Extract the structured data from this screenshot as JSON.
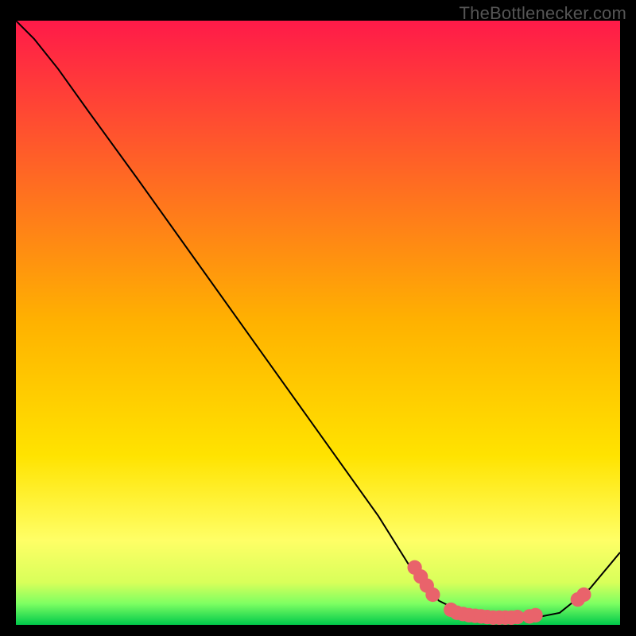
{
  "watermark": "TheBottlenecker.com",
  "chart_data": {
    "type": "line",
    "title": "",
    "xlabel": "",
    "ylabel": "",
    "xlim": [
      0,
      100
    ],
    "ylim": [
      0,
      100
    ],
    "gradient_colors": {
      "top": "#ff1a49",
      "mid": "#ffe300",
      "low_band": "#ffff66",
      "green_top": "#7dff62",
      "green_bottom": "#00c84b"
    },
    "curve": [
      {
        "x": 0,
        "y": 100
      },
      {
        "x": 3,
        "y": 97
      },
      {
        "x": 7,
        "y": 92
      },
      {
        "x": 12,
        "y": 85
      },
      {
        "x": 20,
        "y": 74
      },
      {
        "x": 30,
        "y": 60
      },
      {
        "x": 40,
        "y": 46
      },
      {
        "x": 50,
        "y": 32
      },
      {
        "x": 60,
        "y": 18
      },
      {
        "x": 65,
        "y": 10
      },
      {
        "x": 70,
        "y": 4
      },
      {
        "x": 75,
        "y": 1.5
      },
      {
        "x": 80,
        "y": 1
      },
      {
        "x": 85,
        "y": 1
      },
      {
        "x": 90,
        "y": 2
      },
      {
        "x": 95,
        "y": 6
      },
      {
        "x": 100,
        "y": 12
      }
    ],
    "markers": [
      {
        "x": 66,
        "y": 9.5
      },
      {
        "x": 67,
        "y": 8
      },
      {
        "x": 68,
        "y": 6.5
      },
      {
        "x": 69,
        "y": 5
      },
      {
        "x": 72,
        "y": 2.5
      },
      {
        "x": 73,
        "y": 2
      },
      {
        "x": 74,
        "y": 1.8
      },
      {
        "x": 75,
        "y": 1.6
      },
      {
        "x": 76,
        "y": 1.5
      },
      {
        "x": 77,
        "y": 1.4
      },
      {
        "x": 78,
        "y": 1.3
      },
      {
        "x": 79,
        "y": 1.2
      },
      {
        "x": 80,
        "y": 1.2
      },
      {
        "x": 81,
        "y": 1.2
      },
      {
        "x": 82,
        "y": 1.2
      },
      {
        "x": 83,
        "y": 1.3
      },
      {
        "x": 85,
        "y": 1.4
      },
      {
        "x": 86,
        "y": 1.6
      },
      {
        "x": 93,
        "y": 4.2
      },
      {
        "x": 94,
        "y": 5
      }
    ],
    "marker_color": "#e9636b",
    "marker_radius": 1.2
  }
}
